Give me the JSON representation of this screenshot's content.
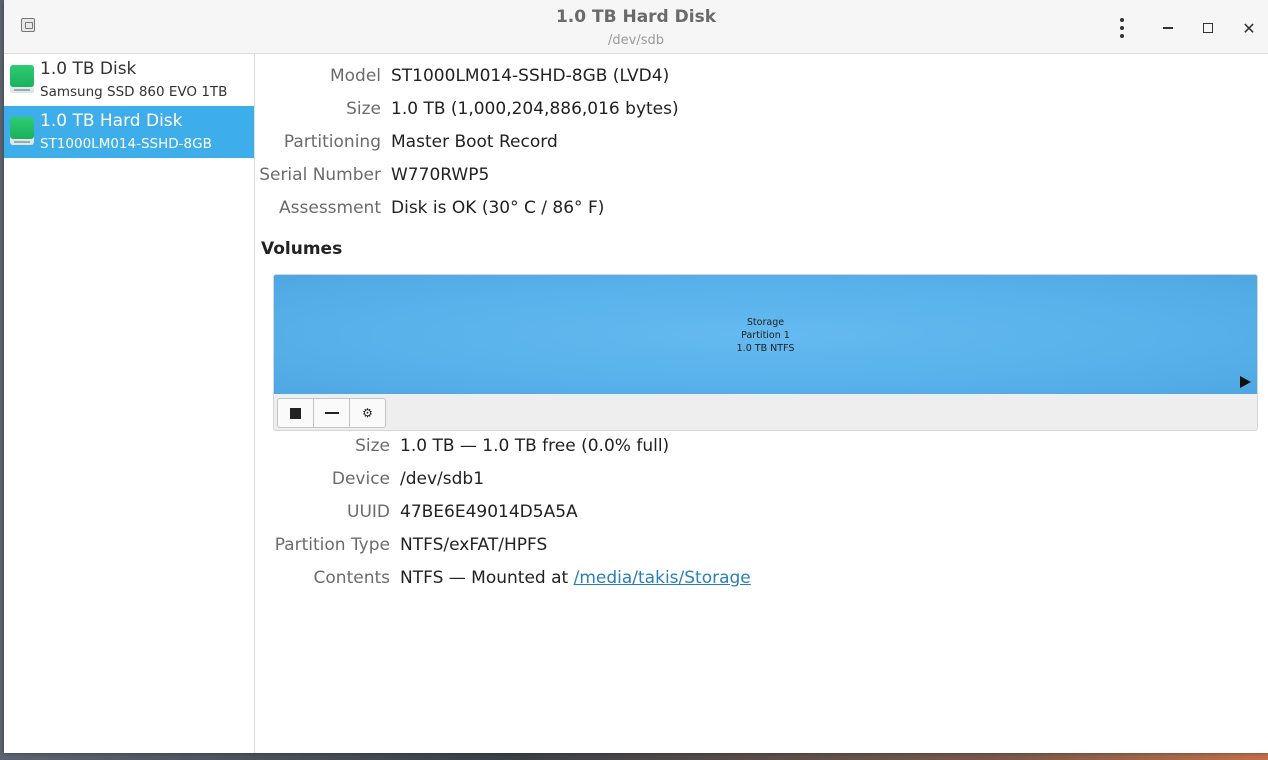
{
  "window": {
    "title": "1.0 TB Hard Disk",
    "subtitle": "/dev/sdb"
  },
  "sidebar": {
    "drives": [
      {
        "name": "1.0 TB Disk",
        "model": "Samsung SSD 860 EVO 1TB",
        "selected": false
      },
      {
        "name": "1.0 TB Hard Disk",
        "model": "ST1000LM014-SSHD-8GB",
        "selected": true
      }
    ]
  },
  "disk": {
    "model_label": "Model",
    "model": "ST1000LM014-SSHD-8GB (LVD4)",
    "size_label": "Size",
    "size": "1.0 TB (1,000,204,886,016 bytes)",
    "partitioning_label": "Partitioning",
    "partitioning": "Master Boot Record",
    "serial_label": "Serial Number",
    "serial": "W770RWP5",
    "assessment_label": "Assessment",
    "assessment": "Disk is OK (30° C / 86° F)"
  },
  "volumes": {
    "title": "Volumes",
    "partition": {
      "line1": "Storage",
      "line2": "Partition 1",
      "line3": "1.0 TB NTFS"
    },
    "details": {
      "size_label": "Size",
      "size": "1.0 TB — 1.0 TB free (0.0% full)",
      "device_label": "Device",
      "device": "/dev/sdb1",
      "uuid_label": "UUID",
      "uuid": "47BE6E49014D5A5A",
      "ptype_label": "Partition Type",
      "ptype": "NTFS/exFAT/HPFS",
      "contents_label": "Contents",
      "contents_prefix": "NTFS — Mounted at ",
      "contents_link": "/media/takis/Storage"
    }
  },
  "colors": {
    "selection": "#3daee9",
    "partition": "#5bb4ec",
    "link": "#2980b9"
  }
}
